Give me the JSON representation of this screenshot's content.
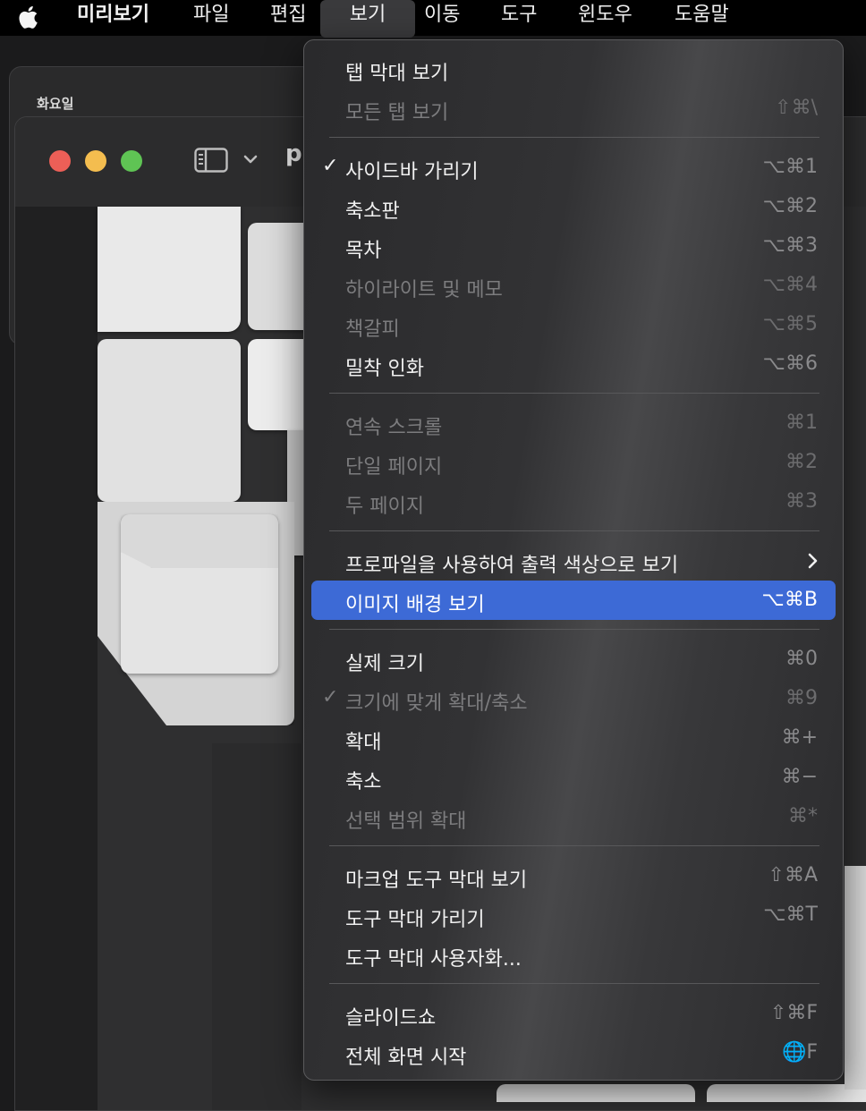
{
  "menubar": {
    "items": [
      {
        "label": "미리보기"
      },
      {
        "label": "파일"
      },
      {
        "label": "편집"
      },
      {
        "label": "보기"
      },
      {
        "label": "이동"
      },
      {
        "label": "도구"
      },
      {
        "label": "윈도우"
      },
      {
        "label": "도움말"
      }
    ]
  },
  "back_window": {
    "label": "화요일"
  },
  "front_window": {
    "title": "p"
  },
  "menu": {
    "items": [
      {
        "check": "",
        "label": "탭 막대 보기",
        "shortcut": ""
      },
      {
        "check": "",
        "label": "모든 탭 보기",
        "shortcut": "⇧⌘\\"
      },
      {
        "check": "✓",
        "label": "사이드바 가리기",
        "shortcut": "⌥⌘1"
      },
      {
        "check": "",
        "label": "축소판",
        "shortcut": "⌥⌘2"
      },
      {
        "check": "",
        "label": "목차",
        "shortcut": "⌥⌘3"
      },
      {
        "check": "",
        "label": "하이라이트 및 메모",
        "shortcut": "⌥⌘4"
      },
      {
        "check": "",
        "label": "책갈피",
        "shortcut": "⌥⌘5"
      },
      {
        "check": "",
        "label": "밀착 인화",
        "shortcut": "⌥⌘6"
      },
      {
        "check": "",
        "label": "연속 스크롤",
        "shortcut": "⌘1"
      },
      {
        "check": "",
        "label": "단일 페이지",
        "shortcut": "⌘2"
      },
      {
        "check": "",
        "label": "두 페이지",
        "shortcut": "⌘3"
      },
      {
        "check": "",
        "label": "프로파일을 사용하여 출력 색상으로 보기",
        "shortcut": ""
      },
      {
        "check": "",
        "label": "이미지 배경 보기",
        "shortcut": "⌥⌘B"
      },
      {
        "check": "",
        "label": "실제 크기",
        "shortcut": "⌘0"
      },
      {
        "check": "✓",
        "label": "크기에 맞게 확대/축소",
        "shortcut": "⌘9"
      },
      {
        "check": "",
        "label": "확대",
        "shortcut": "⌘+"
      },
      {
        "check": "",
        "label": "축소",
        "shortcut": "⌘−"
      },
      {
        "check": "",
        "label": "선택 범위 확대",
        "shortcut": "⌘*"
      },
      {
        "check": "",
        "label": "마크업 도구 막대 보기",
        "shortcut": "⇧⌘A"
      },
      {
        "check": "",
        "label": "도구 막대 가리기",
        "shortcut": "⌥⌘T"
      },
      {
        "check": "",
        "label": "도구 막대 사용자화...",
        "shortcut": ""
      },
      {
        "check": "",
        "label": "슬라이드쇼",
        "shortcut": "⇧⌘F"
      },
      {
        "check": "",
        "label": "전체 화면 시작",
        "shortcut": "🌐F"
      }
    ]
  }
}
